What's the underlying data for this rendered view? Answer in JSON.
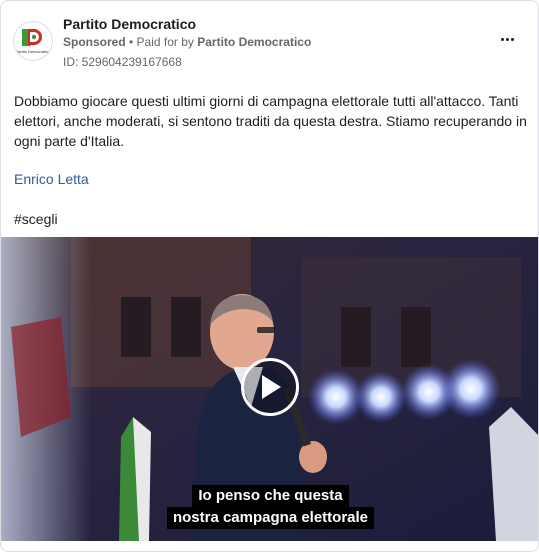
{
  "post": {
    "page_name": "Partito Democratico",
    "sponsored_label": "Sponsored",
    "separator": " • ",
    "paid_for_prefix": "Paid for by ",
    "paid_for_by": "Partito Democratico",
    "ad_id": "ID: 529604239167668",
    "avatar_logo_text": "PD",
    "avatar_caption": "Partito Democratico",
    "more_icon": "ellipsis-icon",
    "body": "Dobbiamo giocare questi ultimi giorni di campagna elettorale tutti all'attacco. Tanti elettori, anche moderati, si sentono traditi da questa destra. Stiamo recuperando in ogni parte d'Italia.",
    "author": "Enrico Letta",
    "hashtag": "#scegli"
  },
  "video": {
    "subtitle_line1": "Io penso che questa",
    "subtitle_line2": "nostra campagna elettorale",
    "play_icon": "play-icon"
  },
  "colors": {
    "link": "#385898",
    "secondary_text": "#65676b",
    "brand_green": "#3a9a3a",
    "brand_red": "#d42a24"
  }
}
